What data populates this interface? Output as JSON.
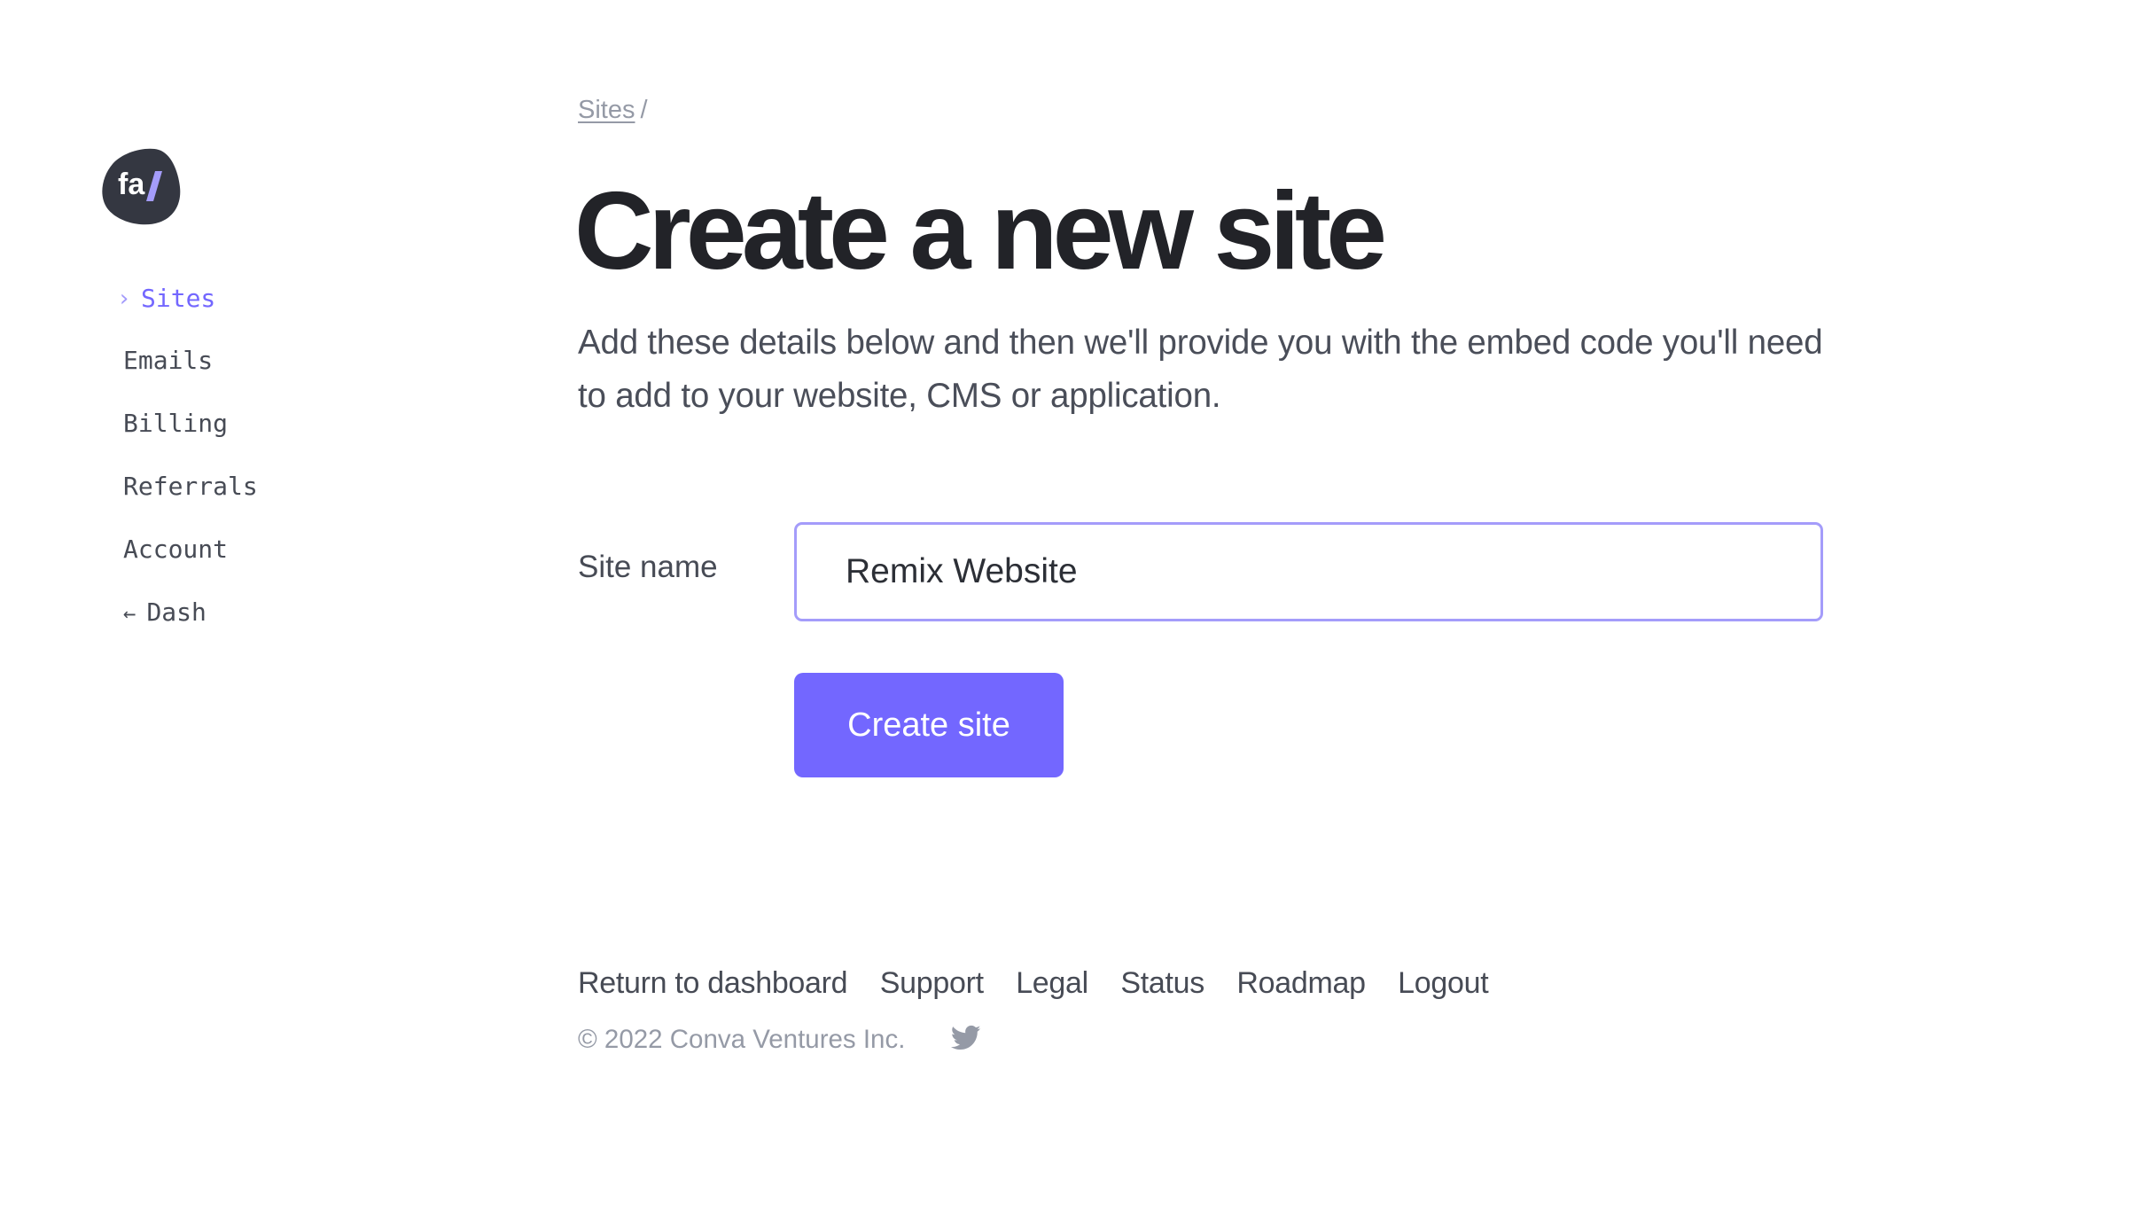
{
  "brand": {
    "logo_text": "fa/",
    "logo_letters": "fa",
    "logo_slash": "/",
    "colors": {
      "logo_bg": "#343741",
      "accent": "#7367FF",
      "accent_light": "#A49CFA",
      "text": "#474B55",
      "heading": "#222328",
      "muted": "#959AA6"
    }
  },
  "sidebar": {
    "items": [
      {
        "label": "Sites",
        "active": true,
        "icon": "chevron-right-icon",
        "icon_glyph": "›"
      },
      {
        "label": "Emails",
        "active": false
      },
      {
        "label": "Billing",
        "active": false
      },
      {
        "label": "Referrals",
        "active": false
      },
      {
        "label": "Account",
        "active": false
      },
      {
        "label": "Dash",
        "active": false,
        "icon": "arrow-left-icon",
        "icon_glyph": "←"
      }
    ]
  },
  "breadcrumb": {
    "items": [
      {
        "label": "Sites"
      }
    ],
    "separator": "/"
  },
  "page": {
    "title": "Create a new site",
    "intro": "Add these details below and then we'll provide you with the embed code you'll need to add to your website, CMS or application."
  },
  "form": {
    "site_name_label": "Site name",
    "site_name_value": "Remix Website",
    "submit_label": "Create site"
  },
  "footer": {
    "links": [
      {
        "label": "Return to dashboard"
      },
      {
        "label": "Support"
      },
      {
        "label": "Legal"
      },
      {
        "label": "Status"
      },
      {
        "label": "Roadmap"
      },
      {
        "label": "Logout"
      }
    ],
    "copyright": "© 2022 Conva Ventures Inc.",
    "social_icon": "twitter-icon"
  }
}
